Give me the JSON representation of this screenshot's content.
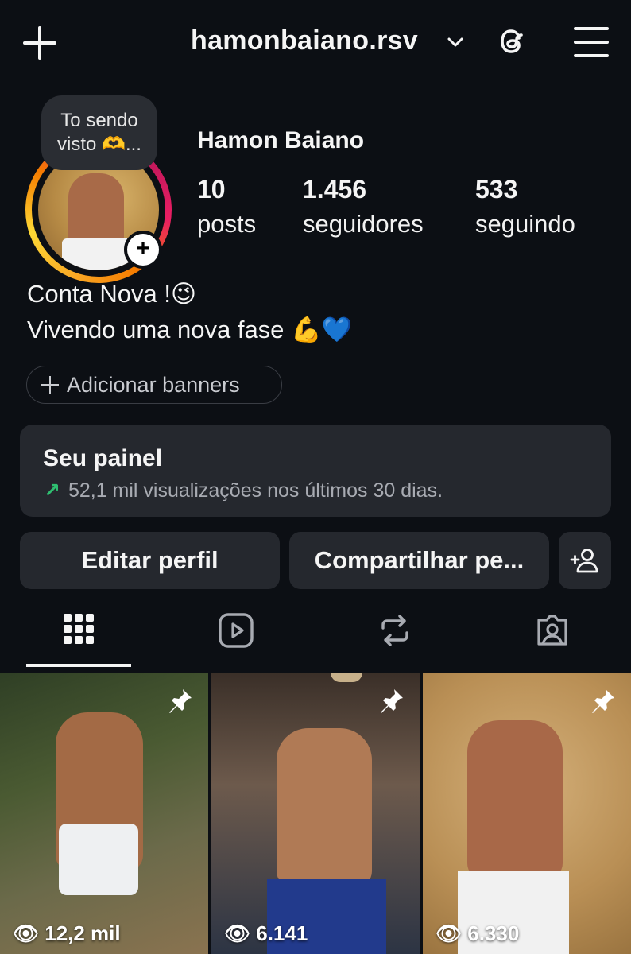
{
  "header": {
    "username": "hamonbaiano.rsv",
    "icons": [
      "plus-icon",
      "chevron-down-icon",
      "threads-icon",
      "menu-icon"
    ]
  },
  "profile": {
    "note_line1": "To sendo",
    "note_line2": "visto 🫶...",
    "display_name": "Hamon Baiano",
    "stats": [
      {
        "value": "10",
        "label": "posts"
      },
      {
        "value": "1.456",
        "label": "seguidores"
      },
      {
        "value": "533",
        "label": "seguindo"
      }
    ],
    "bio_line1": "Conta Nova !😉",
    "bio_line2": "Vivendo uma nova fase 💪💙",
    "add_banners": "Adicionar banners"
  },
  "dashboard": {
    "title": "Seu painel",
    "arrow": "↗",
    "subtitle": "52,1 mil visualizações nos últimos 30 dias."
  },
  "actions": {
    "edit": "Editar perfil",
    "share": "Compartilhar pe..."
  },
  "tabs": [
    "grid-icon",
    "reels-icon",
    "reposts-icon",
    "tagged-icon"
  ],
  "posts": [
    {
      "views": "12,2 mil",
      "pinned": true
    },
    {
      "views": "6.141",
      "pinned": true
    },
    {
      "views": "6.330",
      "pinned": true
    }
  ],
  "colors": {
    "background": "#0c0f14",
    "card": "#25282e",
    "growth_arrow": "#2fbf71"
  }
}
